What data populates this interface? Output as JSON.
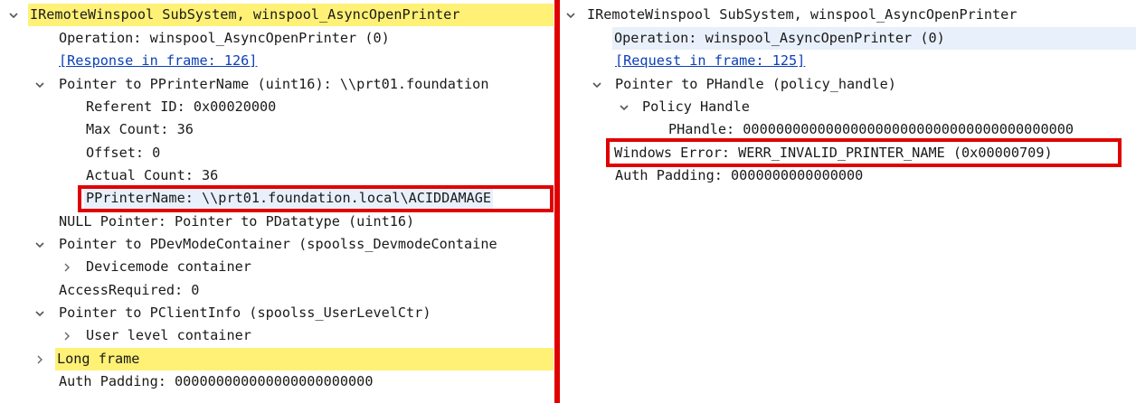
{
  "left": {
    "header": "IRemoteWinspool SubSystem, winspool_AsyncOpenPrinter",
    "operation": "Operation: winspool_AsyncOpenPrinter (0)",
    "response_link": "[Response in frame: 126]",
    "pprinter_ptr": "Pointer to PPrinterName (uint16): \\\\prt01.foundation",
    "referent_id": "Referent ID: 0x00020000",
    "max_count": "Max Count: 36",
    "offset": "Offset: 0",
    "actual_count": "Actual Count: 36",
    "pprinter_name": "PPrinterName: \\\\prt01.foundation.local\\ACIDDAMAGE",
    "null_pointer": "NULL Pointer: Pointer to PDatatype (uint16)",
    "devmode_ptr": "Pointer to PDevModeContainer (spoolss_DevmodeContaine",
    "devmode_container": "Devicemode container",
    "access_required": "AccessRequired: 0",
    "clientinfo_ptr": "Pointer to PClientInfo (spoolss_UserLevelCtr)",
    "user_level": "User level container",
    "long_frame": "Long frame",
    "auth_padding": "Auth Padding: 000000000000000000000000"
  },
  "right": {
    "header": "IRemoteWinspool SubSystem, winspool_AsyncOpenPrinter",
    "operation": "Operation: winspool_AsyncOpenPrinter (0)",
    "request_link": "[Request in frame: 125]",
    "phandle_ptr": "Pointer to PHandle (policy_handle)",
    "policy_handle": "Policy Handle",
    "phandle": "PHandle: 0000000000000000000000000000000000000000",
    "windows_error": "Windows Error: WERR_INVALID_PRINTER_NAME (0x00000709)",
    "auth_padding": "Auth Padding: 0000000000000000"
  },
  "colors": {
    "highlight": "#fff176",
    "selection": "#e8f0fb",
    "annotation": "#e00000",
    "link": "#0b3fb8"
  }
}
